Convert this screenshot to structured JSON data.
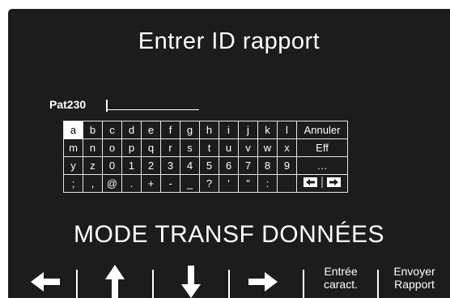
{
  "title": "Entrer ID rapport",
  "input": {
    "value": "Pat230"
  },
  "keyboard": {
    "rows": [
      [
        "a",
        "b",
        "c",
        "d",
        "e",
        "f",
        "g",
        "h",
        "i",
        "j",
        "k",
        "l"
      ],
      [
        "m",
        "n",
        "o",
        "p",
        "q",
        "r",
        "s",
        "t",
        "u",
        "v",
        "w",
        "x"
      ],
      [
        "y",
        "z",
        "0",
        "1",
        "2",
        "3",
        "4",
        "5",
        "6",
        "7",
        "8",
        "9"
      ],
      [
        ";",
        ",",
        "@",
        ".",
        "+",
        "-",
        "_",
        "?",
        "'",
        "\"",
        ":",
        ""
      ]
    ],
    "actions": {
      "cancel": "Annuler",
      "delete": "Eff",
      "more": "…"
    },
    "selected_key": "a"
  },
  "mode": "MODE TRANSF DONNÉES",
  "softkeys": {
    "left_icon": "left-arrow-icon",
    "up_icon": "up-arrow-icon",
    "down_icon": "down-arrow-icon",
    "right_icon": "right-arrow-icon",
    "enter_char": "Entrée caract.",
    "send_report": "Envoyer Rapport"
  },
  "colors": {
    "screen_bg": "#1c1c1c",
    "text": "#ffffff",
    "selected_key_bg": "#ffffff"
  }
}
